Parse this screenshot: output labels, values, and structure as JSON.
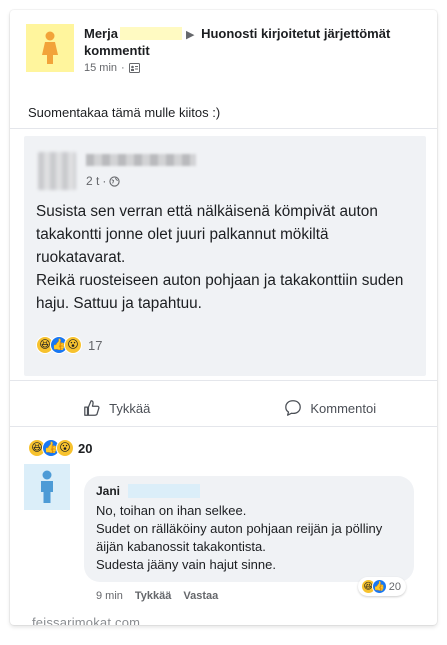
{
  "header": {
    "author": "Merja",
    "group": "Huonosti kirjoitetut järjettömät kommentit",
    "time": "15 min",
    "post_text": "Suomentakaa tämä mulle kiitos :)"
  },
  "shared_post": {
    "time": "2 t",
    "paragraphs": [
      "Susista sen verran että nälkäisenä kömpivät auton takakontti jonne olet juuri palkannut mökiltä ruokatavarat.",
      "Reikä ruosteiseen auton pohjaan  ja  takakonttiin suden haju. Sattuu ja tapahtuu."
    ],
    "reaction_count": "17"
  },
  "actions": {
    "like_label": "Tykkää",
    "comment_label": "Kommentoi"
  },
  "post_reactions": {
    "count": "20"
  },
  "comment": {
    "author": "Jani",
    "lines": [
      "No, toihan on ihan selkee.",
      "Sudet on rälläköiny auton pohjaan reijän ja pölliny äijän kabanossit takakontista.",
      "Sudesta jääny vain hajut sinne."
    ],
    "time": "9 min",
    "like_label": "Tykkää",
    "reply_label": "Vastaa",
    "reaction_count": "20"
  },
  "watermark": "feissarimokat.com",
  "colors": {
    "accent": "#1877f2",
    "yellow_avatar": "#fff59d",
    "blue_avatar": "#dbeef9",
    "person_orange": "#f2a33a",
    "person_blue": "#4d9bd6"
  }
}
